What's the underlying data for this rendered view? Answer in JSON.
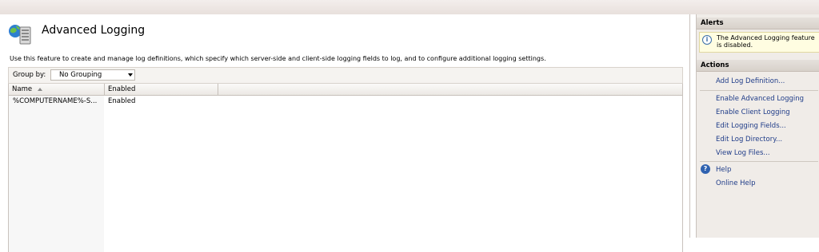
{
  "feature": {
    "title": "Advanced Logging",
    "description": "Use this feature to create and manage log definitions, which specify which server-side and client-side logging fields to log, and to configure additional logging settings."
  },
  "groupby": {
    "label": "Group by:",
    "value": "No Grouping"
  },
  "list": {
    "columns": [
      "Name",
      "Enabled"
    ],
    "rows": [
      {
        "name": "%COMPUTERNAME%-S...",
        "enabled": "Enabled"
      }
    ]
  },
  "actions_pane": {
    "alerts_title": "Alerts",
    "alert_text": "The Advanced Logging feature is disabled.",
    "actions_title": "Actions",
    "items": [
      "Add Log Definition...",
      "Enable Advanced Logging",
      "Enable Client Logging",
      "Edit Logging Fields...",
      "Edit Log Directory...",
      "View Log Files..."
    ],
    "help_label": "Help",
    "online_help_label": "Online Help"
  },
  "icons": {
    "feature": "advanced-logging-icon",
    "alert": "info-icon",
    "help": "help-icon",
    "sort": "sort-ascending-icon",
    "dropdown": "chevron-down-icon"
  }
}
